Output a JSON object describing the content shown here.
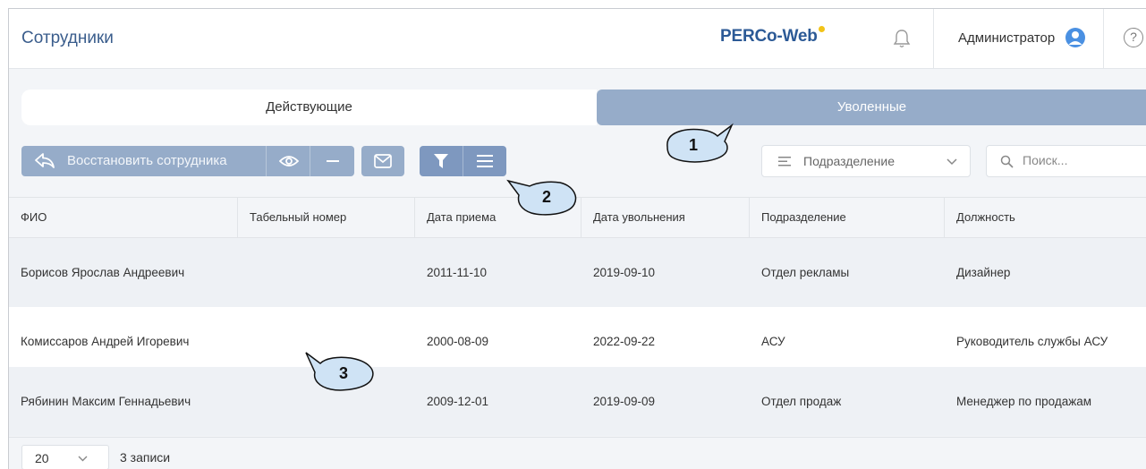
{
  "header": {
    "title": "Сотрудники",
    "logo": "PERCo-Web",
    "user": "Администратор",
    "help_symbol": "?"
  },
  "tabs": [
    {
      "label": "Действующие",
      "active": false
    },
    {
      "label": "Уволенные",
      "active": true
    }
  ],
  "toolbar": {
    "restore_label": "Восстановить сотрудника",
    "department_select": "Подразделение",
    "search_placeholder": "Поиск..."
  },
  "table": {
    "columns": [
      "ФИО",
      "Табельный номер",
      "Дата приема",
      "Дата увольнения",
      "Подразделение",
      "Должность"
    ],
    "rows": [
      [
        "Борисов Ярослав Андреевич",
        "",
        "2011-11-10",
        "2019-09-10",
        "Отдел рекламы",
        "Дизайнер"
      ],
      [
        "Комиссаров Андрей Игоревич",
        "",
        "2000-08-09",
        "2022-09-22",
        "АСУ",
        "Руководитель службы АСУ"
      ],
      [
        "Рябинин Максим Геннадьевич",
        "",
        "2009-12-01",
        "2019-09-09",
        "Отдел продаж",
        "Менеджер по продажам"
      ]
    ]
  },
  "footer": {
    "page_size": "20",
    "records_count": "3 записи"
  },
  "callouts": [
    "1",
    "2",
    "3"
  ],
  "colors": {
    "accent": "#96acc9",
    "accent_dark": "#7e98bf",
    "title": "#3a5d8c",
    "logo_dot": "#f2c318",
    "callout_fill": "#cfe3f5"
  }
}
